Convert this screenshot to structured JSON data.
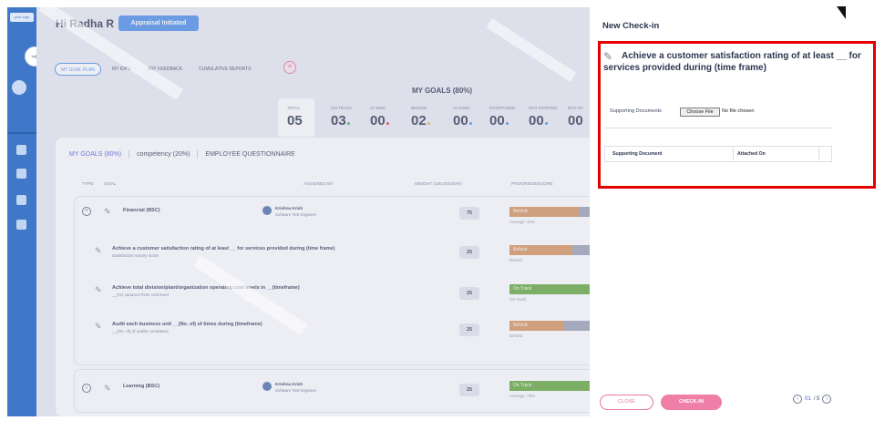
{
  "sidebar": {
    "logo_text": "your logo"
  },
  "header": {
    "greeting": "Hi Radha R",
    "status": "Appraisal Initiated"
  },
  "tabs": [
    "MY GOAL PLAN",
    "MY IDPS",
    "360° FEEDBACK",
    "CUMULATIVE REPORTS"
  ],
  "summary": {
    "title": "MY GOALS (80%)",
    "stats": [
      {
        "label": "TOTAL",
        "value": "05",
        "color": ""
      },
      {
        "label": "ON TRACK",
        "value": "03",
        "color": "#3cb54a"
      },
      {
        "label": "AT RISK",
        "value": "00",
        "color": "#e53935"
      },
      {
        "label": "BEHIND",
        "value": "02",
        "color": "#f0a93a"
      },
      {
        "label": "CLOSED",
        "value": "00",
        "color": "#4b8ee8"
      },
      {
        "label": "POSTPONED",
        "value": "00",
        "color": "#4b8ee8"
      },
      {
        "label": "NOT STARTED",
        "value": "00",
        "color": "#4b8ee8"
      },
      {
        "label": "NOT AP",
        "value": "00",
        "color": "#4b8ee8"
      }
    ]
  },
  "subtabs": [
    "MY GOALS (80%)",
    "competency (20%)",
    "EMPLOYEE QUESTIONNAIRE"
  ],
  "columns": {
    "type": "TYPE",
    "goal": "GOAL",
    "assigned_by": "ASSIGNED BY",
    "weight": "WEIGHT (100.00/100%)",
    "progress": "PROGRESS/SCORE"
  },
  "goals": {
    "financial": {
      "name": "Financial (BSC)",
      "assignee": "Krishna Krish",
      "role": "Software Test Engineer",
      "weight": "75",
      "status": "Behind",
      "caption": "Average: 34%",
      "progress": 0.84,
      "color": "#d7925a",
      "subgoals": [
        {
          "name": "Achieve a customer satisfaction rating of at least __ for services provided during (time frame)",
          "sub": "Satisfaction survey score",
          "weight": "25",
          "status": "Behind",
          "caption": "Behind",
          "progress": 0.77,
          "color": "#d7925a"
        },
        {
          "name": "Achieve total division/plant/organization operating cost levels in __(timeframe)",
          "sub": "__(%) variance from cost level",
          "weight": "25",
          "status": "On Track",
          "caption": "On Track",
          "progress": 1.0,
          "color": "#63a83a"
        },
        {
          "name": "Audit each business unit __(No. of) of times during (timeframe)",
          "sub": "__(No. of) of audits completed",
          "weight": "25",
          "status": "Behind",
          "caption": "Behind",
          "progress": 0.67,
          "color": "#d7925a"
        }
      ]
    },
    "learning": {
      "name": "Learning (BSC)",
      "assignee": "Krishna Krish",
      "role": "Software Test Engineer",
      "weight": "25",
      "status": "On Track",
      "caption": "Average: 79%",
      "progress": 1.0,
      "color": "#63a83a"
    }
  },
  "drawer": {
    "title": "New Check-in",
    "goal_title": "Achieve a customer satisfaction rating of at least __ for services provided during (time frame)",
    "supporting_label": "Supporting Documents",
    "choose_file": "Choose File",
    "no_file": "No file chosen",
    "table_headers": {
      "document": "Supporting Document",
      "attached_on": "Attached On"
    },
    "close_label": "CLOSE",
    "checkin_label": "CHECK-IN",
    "pager": {
      "current": "01",
      "total": "/ 5"
    }
  }
}
